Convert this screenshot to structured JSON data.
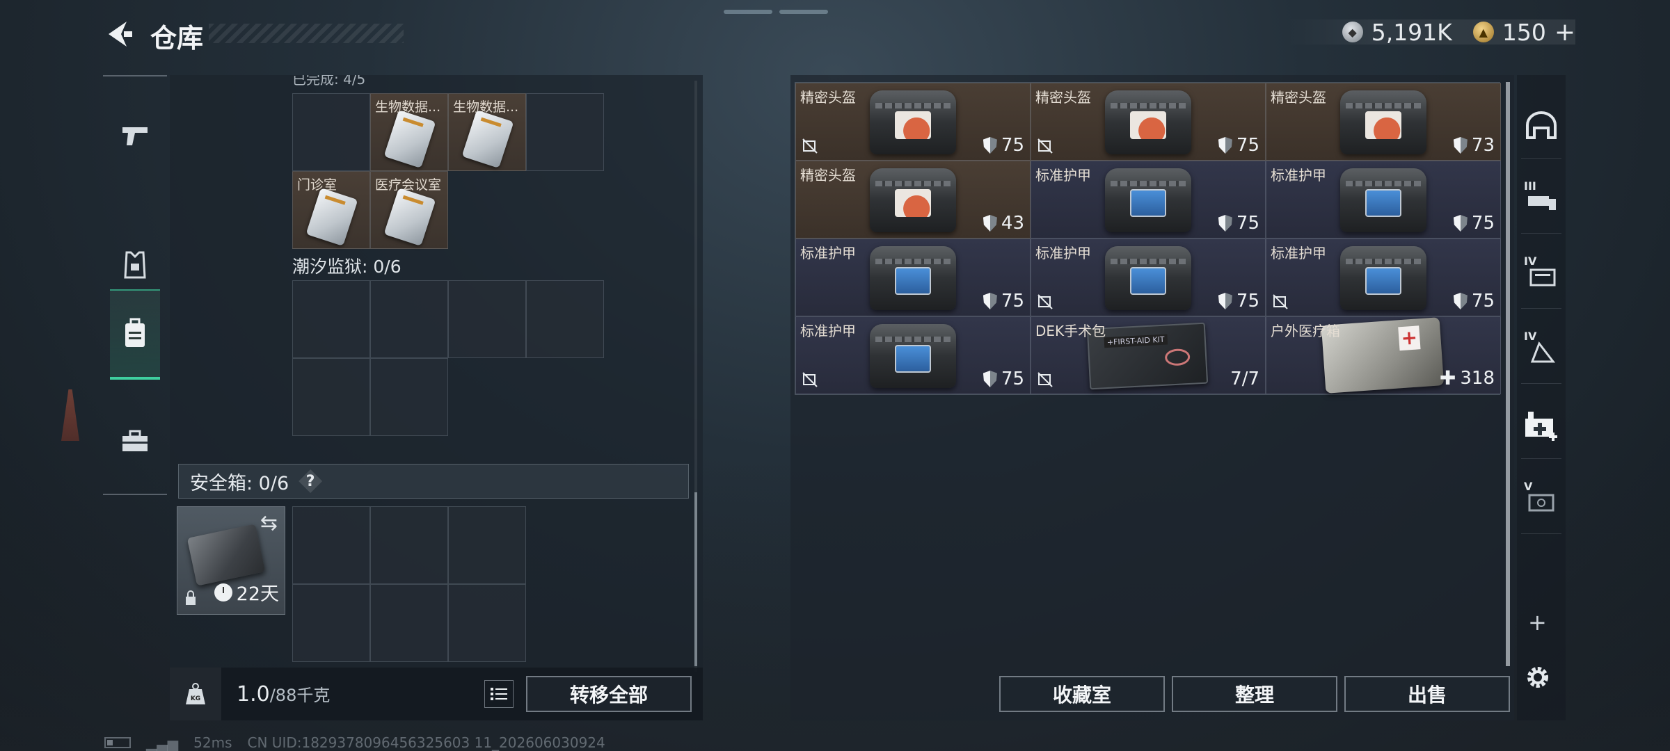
{
  "header": {
    "title": "仓库",
    "currency_main": "5,191K",
    "currency_premium": "150",
    "premium_plus": "+"
  },
  "left_rail": [
    {
      "icon": "pistol-icon",
      "active": false
    },
    {
      "icon": "armor-vest-icon",
      "active": false
    },
    {
      "icon": "backpack-icon",
      "active": true
    },
    {
      "icon": "toolbox-icon",
      "active": false
    }
  ],
  "left_panel": {
    "top_cut_label": "已完成: 4/5",
    "keycards": [
      {
        "label": "生物数据..."
      },
      {
        "label": "生物数据..."
      },
      {
        "label": "门诊室"
      },
      {
        "label": "医疗会议室"
      }
    ],
    "prison_label": "潮汐监狱: 0/6",
    "safe": {
      "label": "安全箱: 0/6",
      "help": "?",
      "days": "22天"
    },
    "weight": {
      "current": "1.0",
      "max": "/88千克"
    },
    "transfer_all": "转移全部"
  },
  "items": [
    {
      "name": "精密头盔",
      "tier": "gold",
      "kind": "helmet",
      "durability": "75",
      "no_sell": true
    },
    {
      "name": "精密头盔",
      "tier": "gold",
      "kind": "helmet",
      "durability": "75",
      "no_sell": true
    },
    {
      "name": "精密头盔",
      "tier": "gold",
      "kind": "helmet",
      "durability": "73",
      "no_sell": false
    },
    {
      "name": "精密头盔",
      "tier": "gold",
      "kind": "helmet",
      "durability": "43",
      "no_sell": false
    },
    {
      "name": "标准护甲",
      "tier": "purple",
      "kind": "armor",
      "durability": "75",
      "no_sell": false
    },
    {
      "name": "标准护甲",
      "tier": "purple",
      "kind": "armor",
      "durability": "75",
      "no_sell": false
    },
    {
      "name": "标准护甲",
      "tier": "purple",
      "kind": "armor",
      "durability": "75",
      "no_sell": false
    },
    {
      "name": "标准护甲",
      "tier": "purple",
      "kind": "armor",
      "durability": "75",
      "no_sell": true
    },
    {
      "name": "标准护甲",
      "tier": "purple",
      "kind": "armor",
      "durability": "75",
      "no_sell": true
    },
    {
      "name": "标准护甲",
      "tier": "purple",
      "kind": "armor",
      "durability": "75",
      "no_sell": true
    },
    {
      "name": "DEK手术包",
      "tier": "purple",
      "kind": "kit",
      "durability": "7/7",
      "no_sell": true
    },
    {
      "name": "户外医疗箱",
      "tier": "purple",
      "kind": "medbox",
      "durability": "318",
      "no_sell": false
    }
  ],
  "right_buttons": {
    "collection": "收藏室",
    "sort": "整理",
    "sell": "出售"
  },
  "right_rail": [
    {
      "icon": "helmet-slot-icon",
      "roman": ""
    },
    {
      "icon": "armor-slot-icon",
      "roman": "III"
    },
    {
      "icon": "rig-slot-icon",
      "roman": "IV"
    },
    {
      "icon": "backpack-slot-icon",
      "roman": "IV"
    },
    {
      "icon": "medical-slot-icon",
      "roman": ""
    },
    {
      "icon": "safe-slot-icon",
      "roman": "V"
    }
  ],
  "status": {
    "ping": "52ms",
    "uid": "CN UID:1829378096456325603 11_202606030924"
  }
}
